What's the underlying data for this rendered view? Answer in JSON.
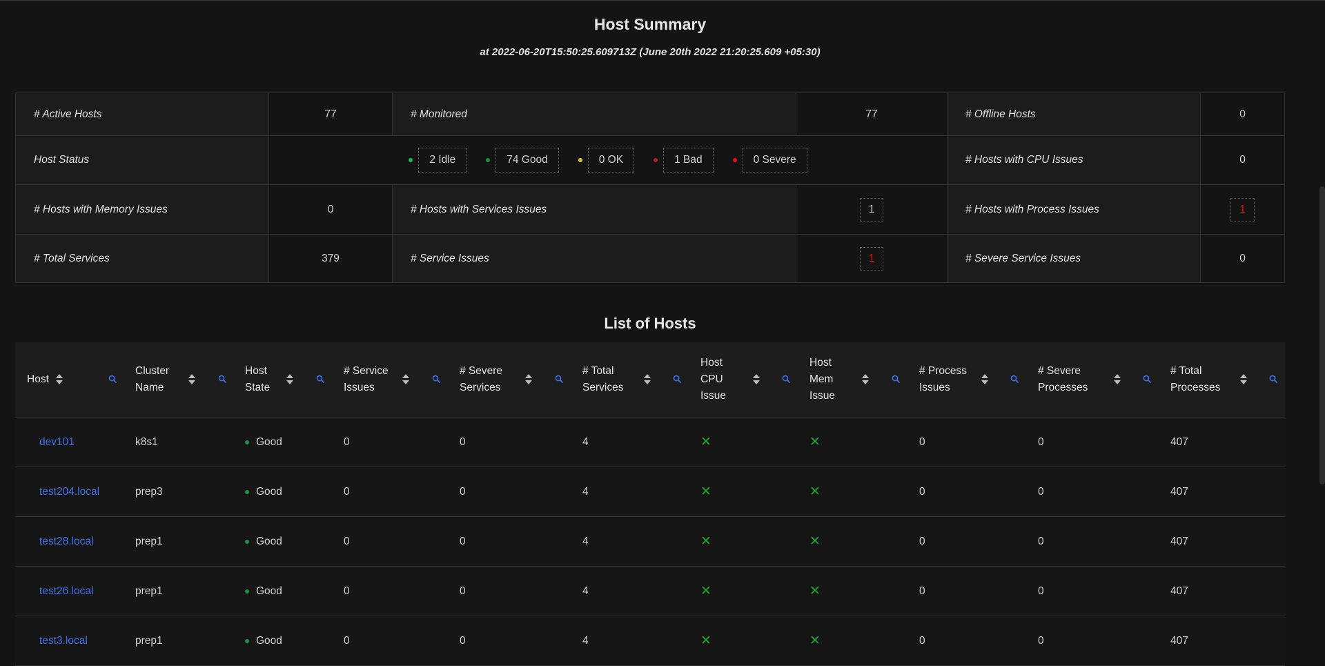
{
  "summary": {
    "title": "Host Summary",
    "timestamp": "at 2022-06-20T15:50:25.609713Z (June 20th 2022 21:20:25.609 +05:30)",
    "active_hosts_label": "# Active Hosts",
    "active_hosts_value": "77",
    "monitored_label": "# Monitored",
    "monitored_value": "77",
    "offline_label": "# Offline Hosts",
    "offline_value": "0",
    "host_status_label": "Host Status",
    "status_idle": "2 Idle",
    "status_good": "74 Good",
    "status_ok": "0 OK",
    "status_bad": "1 Bad",
    "status_severe": "0 Severe",
    "cpu_issues_label": "# Hosts with CPU Issues",
    "cpu_issues_value": "0",
    "mem_issues_label": "# Hosts with Memory Issues",
    "mem_issues_value": "0",
    "svc_issues_hosts_label": "# Hosts with Services Issues",
    "svc_issues_hosts_value": "1",
    "proc_issues_label": "# Hosts with Process Issues",
    "proc_issues_value": "1",
    "total_services_label": "# Total Services",
    "total_services_value": "379",
    "service_issues_label": "# Service Issues",
    "service_issues_value": "1",
    "severe_service_label": "# Severe Service Issues",
    "severe_service_value": "0"
  },
  "colors": {
    "idle": "#1db954",
    "good": "#1f8f4a",
    "ok": "#c9c91e",
    "bad": "#c21818",
    "severe": "#e0141e",
    "link": "#3f6fe8"
  },
  "list": {
    "title": "List of Hosts",
    "columns": [
      "Host",
      "Cluster Name",
      "Host State",
      "# Service Issues",
      "# Severe Services",
      "# Total Services",
      "Host CPU Issue",
      "Host Mem Issue",
      "# Process Issues",
      "# Severe Processes",
      "# Total Processes"
    ],
    "rows": [
      {
        "host": "dev101",
        "cluster": "k8s1",
        "state": "Good",
        "svc_issues": "0",
        "severe_svcs": "0",
        "total_svcs": "4",
        "cpu": "✕",
        "mem": "✕",
        "proc_issues": "0",
        "severe_procs": "0",
        "total_procs": "407"
      },
      {
        "host": "test204.local",
        "cluster": "prep3",
        "state": "Good",
        "svc_issues": "0",
        "severe_svcs": "0",
        "total_svcs": "4",
        "cpu": "✕",
        "mem": "✕",
        "proc_issues": "0",
        "severe_procs": "0",
        "total_procs": "407"
      },
      {
        "host": "test28.local",
        "cluster": "prep1",
        "state": "Good",
        "svc_issues": "0",
        "severe_svcs": "0",
        "total_svcs": "4",
        "cpu": "✕",
        "mem": "✕",
        "proc_issues": "0",
        "severe_procs": "0",
        "total_procs": "407"
      },
      {
        "host": "test26.local",
        "cluster": "prep1",
        "state": "Good",
        "svc_issues": "0",
        "severe_svcs": "0",
        "total_svcs": "4",
        "cpu": "✕",
        "mem": "✕",
        "proc_issues": "0",
        "severe_procs": "0",
        "total_procs": "407"
      },
      {
        "host": "test3.local",
        "cluster": "prep1",
        "state": "Good",
        "svc_issues": "0",
        "severe_svcs": "0",
        "total_svcs": "4",
        "cpu": "✕",
        "mem": "✕",
        "proc_issues": "0",
        "severe_procs": "0",
        "total_procs": "407"
      }
    ]
  }
}
